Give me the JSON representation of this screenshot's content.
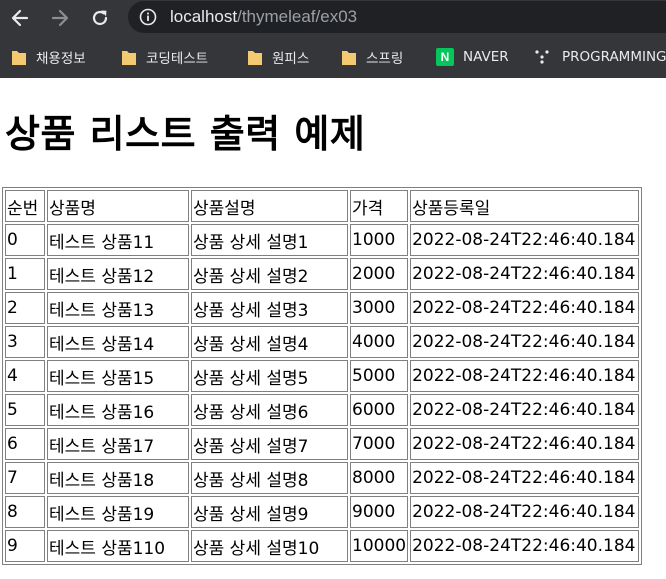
{
  "browser": {
    "url_host": "localhost",
    "url_path": "/thymeleaf/ex03",
    "bookmarks": [
      {
        "label": "채용정보",
        "icon": "folder-icon"
      },
      {
        "label": "코딩테스트",
        "icon": "folder-icon"
      },
      {
        "label": "원피스",
        "icon": "folder-icon"
      },
      {
        "label": "스프링",
        "icon": "folder-icon"
      },
      {
        "label": "NAVER",
        "icon": "naver-icon"
      },
      {
        "label": "PROGRAMMING",
        "icon": "dots-icon"
      }
    ],
    "naver_letter": "N",
    "colors": {
      "chrome": "#35363a",
      "urlbar": "#202124",
      "folder": "#f3ca6f",
      "naver": "#03c75a"
    }
  },
  "page": {
    "title": "상품 리스트 출력 예제"
  },
  "table": {
    "headers": [
      "순번",
      "상품명",
      "상품설명",
      "가격",
      "상품등록일"
    ],
    "rows": [
      [
        "0",
        "테스트 상품11",
        "상품 상세 설명1",
        "1000",
        "2022-08-24T22:46:40.184"
      ],
      [
        "1",
        "테스트 상품12",
        "상품 상세 설명2",
        "2000",
        "2022-08-24T22:46:40.184"
      ],
      [
        "2",
        "테스트 상품13",
        "상품 상세 설명3",
        "3000",
        "2022-08-24T22:46:40.184"
      ],
      [
        "3",
        "테스트 상품14",
        "상품 상세 설명4",
        "4000",
        "2022-08-24T22:46:40.184"
      ],
      [
        "4",
        "테스트 상품15",
        "상품 상세 설명5",
        "5000",
        "2022-08-24T22:46:40.184"
      ],
      [
        "5",
        "테스트 상품16",
        "상품 상세 설명6",
        "6000",
        "2022-08-24T22:46:40.184"
      ],
      [
        "6",
        "테스트 상품17",
        "상품 상세 설명7",
        "7000",
        "2022-08-24T22:46:40.184"
      ],
      [
        "7",
        "테스트 상품18",
        "상품 상세 설명8",
        "8000",
        "2022-08-24T22:46:40.184"
      ],
      [
        "8",
        "테스트 상품19",
        "상품 상세 설명9",
        "9000",
        "2022-08-24T22:46:40.184"
      ],
      [
        "9",
        "테스트 상품110",
        "상품 상세 설명10",
        "10000",
        "2022-08-24T22:46:40.184"
      ]
    ]
  }
}
